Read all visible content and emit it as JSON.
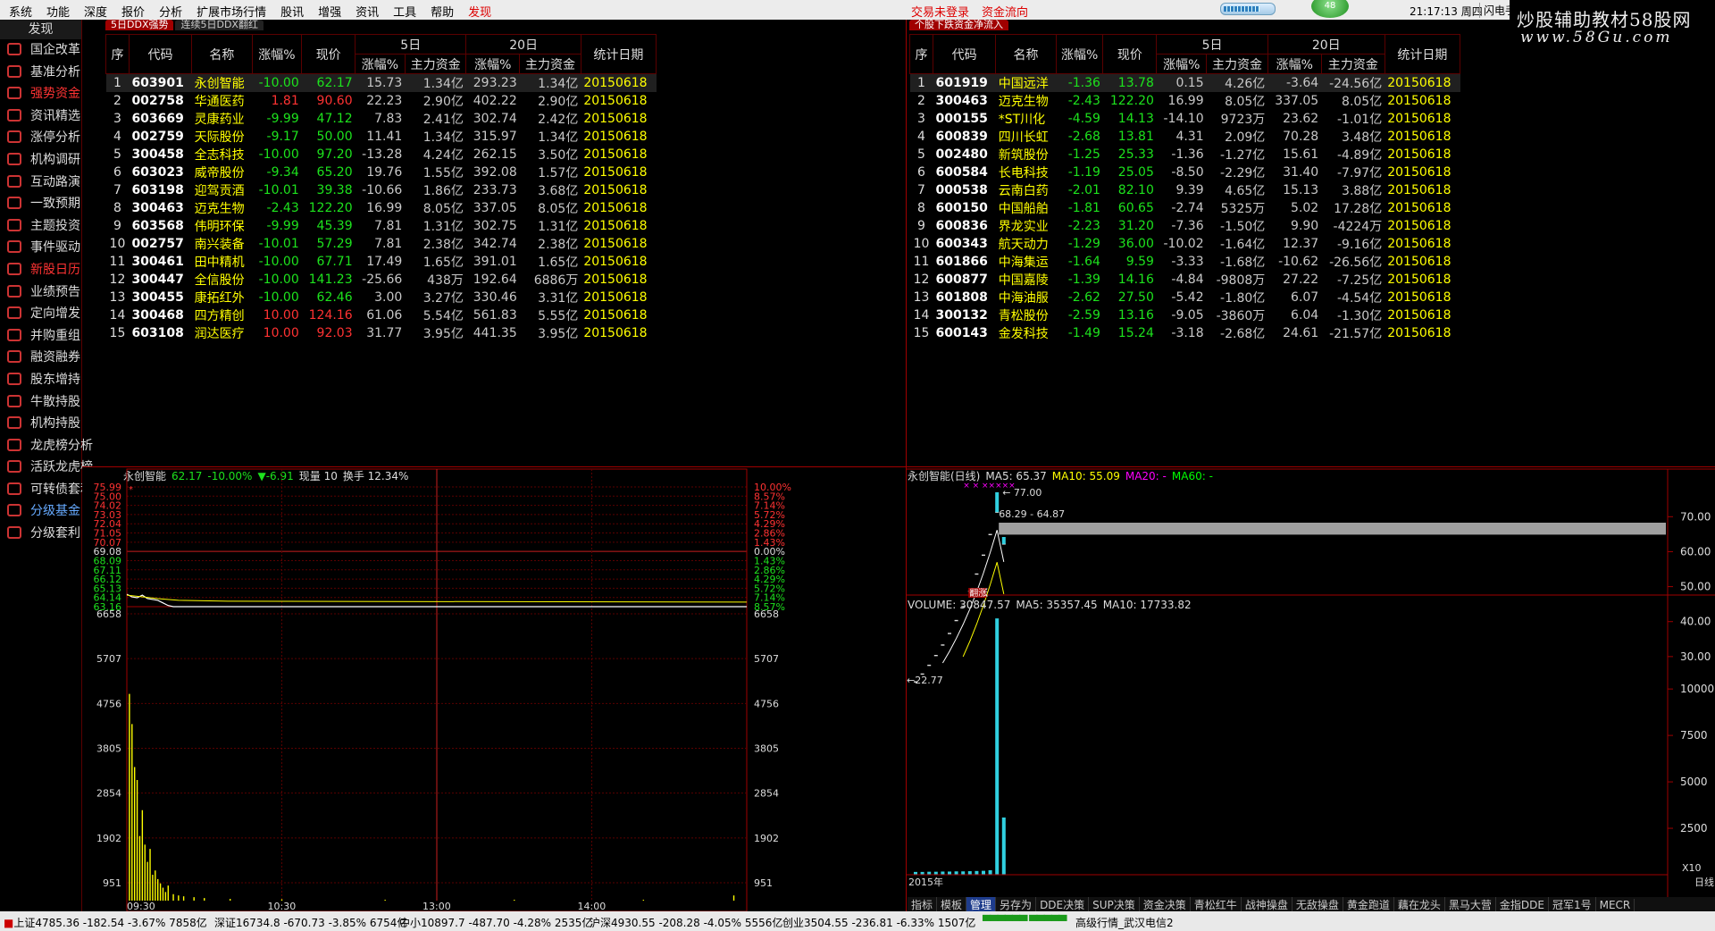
{
  "menu": [
    "系统",
    "功能",
    "深度",
    "报价",
    "分析",
    "扩展市场行情",
    "股讯",
    "增强",
    "资讯",
    "工具",
    "帮助",
    "发现"
  ],
  "login": {
    "a": "交易未登录",
    "b": "资金流向"
  },
  "orb": "48",
  "clock": "21:17:13 周四",
  "flash": "闪电手",
  "watermark": {
    "line1": "炒股辅助教材58股网",
    "line2": "www.58Gu.com"
  },
  "sidebar": {
    "title": "发现",
    "items": [
      "国企改革",
      "基准分析",
      "强势资金",
      "资讯精选",
      "涨停分析",
      "机构调研",
      "互动路演",
      "一致预期",
      "主题投资",
      "事件驱动",
      "新股日历",
      "业绩预告",
      "定向增发",
      "并购重组",
      "融资融券",
      "股东增持",
      "牛散持股",
      "机构持股",
      "龙虎榜分析",
      "活跃龙虎榜",
      "可转债套利",
      "分级基金",
      "分级套利"
    ]
  },
  "left_tabs": [
    "5日DDX强势",
    "连续5日DDX翻红"
  ],
  "right_tabs": [
    "个股下跌资金净流入"
  ],
  "headers": {
    "seq": "序",
    "code": "代码",
    "name": "名称",
    "pct": "涨幅%",
    "price": "现价",
    "d5": "5日",
    "d20": "20日",
    "sub_pct": "涨幅%",
    "sub_fund": "主力资金",
    "date": "统计日期"
  },
  "left_rows": [
    [
      "1",
      "603901",
      "永创智能",
      "-10.00",
      "62.17",
      "15.73",
      "1.34亿",
      "293.23",
      "1.34亿",
      "20150618"
    ],
    [
      "2",
      "002758",
      "华通医药",
      "1.81",
      "90.60",
      "22.23",
      "2.90亿",
      "402.22",
      "2.90亿",
      "20150618"
    ],
    [
      "3",
      "603669",
      "灵康药业",
      "-9.99",
      "47.12",
      "7.83",
      "2.41亿",
      "302.74",
      "2.42亿",
      "20150618"
    ],
    [
      "4",
      "002759",
      "天际股份",
      "-9.17",
      "50.00",
      "11.41",
      "1.34亿",
      "315.97",
      "1.34亿",
      "20150618"
    ],
    [
      "5",
      "300458",
      "全志科技",
      "-10.00",
      "97.20",
      "-13.28",
      "4.24亿",
      "262.15",
      "3.50亿",
      "20150618"
    ],
    [
      "6",
      "603023",
      "威帝股份",
      "-9.34",
      "65.20",
      "19.76",
      "1.55亿",
      "392.08",
      "1.57亿",
      "20150618"
    ],
    [
      "7",
      "603198",
      "迎驾贡酒",
      "-10.01",
      "39.38",
      "-10.66",
      "1.86亿",
      "233.73",
      "3.68亿",
      "20150618"
    ],
    [
      "8",
      "300463",
      "迈克生物",
      "-2.43",
      "122.20",
      "16.99",
      "8.05亿",
      "337.05",
      "8.05亿",
      "20150618"
    ],
    [
      "9",
      "603568",
      "伟明环保",
      "-9.99",
      "45.39",
      "7.81",
      "1.31亿",
      "302.75",
      "1.31亿",
      "20150618"
    ],
    [
      "10",
      "002757",
      "南兴装备",
      "-10.01",
      "57.29",
      "7.81",
      "2.38亿",
      "342.74",
      "2.38亿",
      "20150618"
    ],
    [
      "11",
      "300461",
      "田中精机",
      "-10.00",
      "67.71",
      "17.49",
      "1.65亿",
      "391.01",
      "1.65亿",
      "20150618"
    ],
    [
      "12",
      "300447",
      "全信股份",
      "-10.00",
      "141.23",
      "-25.66",
      "438万",
      "192.64",
      "6886万",
      "20150618"
    ],
    [
      "13",
      "300455",
      "康拓红外",
      "-10.00",
      "62.46",
      "3.00",
      "3.27亿",
      "330.46",
      "3.31亿",
      "20150618"
    ],
    [
      "14",
      "300468",
      "四方精创",
      "10.00",
      "124.16",
      "61.06",
      "5.54亿",
      "561.83",
      "5.55亿",
      "20150618"
    ],
    [
      "15",
      "603108",
      "润达医疗",
      "10.00",
      "92.03",
      "31.77",
      "3.95亿",
      "441.35",
      "3.95亿",
      "20150618"
    ]
  ],
  "right_rows": [
    [
      "1",
      "601919",
      "中国远洋",
      "-1.36",
      "13.78",
      "0.15",
      "4.26亿",
      "-3.64",
      "-24.56亿",
      "20150618"
    ],
    [
      "2",
      "300463",
      "迈克生物",
      "-2.43",
      "122.20",
      "16.99",
      "8.05亿",
      "337.05",
      "8.05亿",
      "20150618"
    ],
    [
      "3",
      "000155",
      "*ST川化",
      "-4.59",
      "14.13",
      "-14.10",
      "9723万",
      "23.62",
      "-1.01亿",
      "20150618"
    ],
    [
      "4",
      "600839",
      "四川长虹",
      "-2.68",
      "13.81",
      "4.31",
      "2.09亿",
      "70.28",
      "3.48亿",
      "20150618"
    ],
    [
      "5",
      "002480",
      "新筑股份",
      "-1.25",
      "25.33",
      "-1.36",
      "-1.27亿",
      "15.61",
      "-4.89亿",
      "20150618"
    ],
    [
      "6",
      "600584",
      "长电科技",
      "-1.19",
      "25.05",
      "-8.50",
      "-2.29亿",
      "31.40",
      "-7.97亿",
      "20150618"
    ],
    [
      "7",
      "000538",
      "云南白药",
      "-2.01",
      "82.10",
      "9.39",
      "4.65亿",
      "15.13",
      "3.88亿",
      "20150618"
    ],
    [
      "8",
      "600150",
      "中国船舶",
      "-1.81",
      "60.65",
      "-2.74",
      "5325万",
      "5.02",
      "17.28亿",
      "20150618"
    ],
    [
      "9",
      "600836",
      "界龙实业",
      "-2.23",
      "31.20",
      "-7.36",
      "-1.50亿",
      "9.90",
      "-4224万",
      "20150618"
    ],
    [
      "10",
      "600343",
      "航天动力",
      "-1.29",
      "36.00",
      "-10.02",
      "-1.64亿",
      "12.37",
      "-9.16亿",
      "20150618"
    ],
    [
      "11",
      "601866",
      "中海集运",
      "-1.64",
      "9.59",
      "-3.33",
      "-1.68亿",
      "-10.62",
      "-26.56亿",
      "20150618"
    ],
    [
      "12",
      "600877",
      "中国嘉陵",
      "-1.39",
      "14.16",
      "-4.84",
      "-9808万",
      "27.22",
      "-7.25亿",
      "20150618"
    ],
    [
      "13",
      "601808",
      "中海油服",
      "-2.62",
      "27.50",
      "-5.42",
      "-1.80亿",
      "6.07",
      "-4.54亿",
      "20150618"
    ],
    [
      "14",
      "300132",
      "青松股份",
      "-2.59",
      "13.16",
      "-9.05",
      "-3860万",
      "6.04",
      "-1.30亿",
      "20150618"
    ],
    [
      "15",
      "600143",
      "金发科技",
      "-1.49",
      "15.24",
      "-3.18",
      "-2.68亿",
      "24.61",
      "-21.57亿",
      "20150618"
    ]
  ],
  "chart_data": [
    {
      "type": "line",
      "title_name": "永创智能",
      "title_price": "62.17",
      "title_pct": "-10.00%",
      "title_chg": "▼-6.91",
      "title_vol": "现量 10",
      "title_turn": "换手 12.34%",
      "y_labels": [
        "75.99",
        "75.00",
        "74.02",
        "73.03",
        "72.04",
        "71.05",
        "70.07",
        "69.08",
        "68.09",
        "67.11",
        "66.12",
        "65.13",
        "64.14",
        "63.16"
      ],
      "pct_labels": [
        "10.00%",
        "8.57%",
        "7.14%",
        "5.72%",
        "4.29%",
        "2.86%",
        "1.43%",
        "0.00%",
        "1.43%",
        "2.86%",
        "4.29%",
        "5.72%",
        "7.14%",
        "8.57%"
      ],
      "vol_labels": [
        "6658",
        "5707",
        "4756",
        "3805",
        "2854",
        "1902",
        "951"
      ],
      "x_labels": [
        "09:30",
        "10:30",
        "13:00",
        "14:00"
      ],
      "ylim": [
        62.17,
        75.99
      ],
      "preclose": 69.08,
      "price": [
        [
          0,
          63.6
        ],
        [
          2,
          63.3
        ],
        [
          4,
          63.2
        ],
        [
          6,
          63.5
        ],
        [
          8,
          63.1
        ],
        [
          10,
          63.0
        ],
        [
          12,
          62.9
        ],
        [
          14,
          62.6
        ],
        [
          16,
          62.3
        ],
        [
          18,
          62.17
        ],
        [
          240,
          62.17
        ]
      ],
      "avg": [
        [
          0,
          63.5
        ],
        [
          6,
          63.3
        ],
        [
          12,
          63.1
        ],
        [
          20,
          62.9
        ],
        [
          40,
          62.8
        ],
        [
          240,
          62.7
        ]
      ],
      "volume_max": 6658,
      "volume": [
        [
          1,
          4800
        ],
        [
          2,
          4100
        ],
        [
          3,
          3100
        ],
        [
          4,
          2800
        ],
        [
          5,
          1500
        ],
        [
          6,
          2100
        ],
        [
          7,
          1300
        ],
        [
          8,
          900
        ],
        [
          9,
          1200
        ],
        [
          10,
          600
        ],
        [
          11,
          700
        ],
        [
          12,
          500
        ],
        [
          13,
          400
        ],
        [
          14,
          300
        ],
        [
          15,
          200
        ],
        [
          16,
          350
        ],
        [
          18,
          150
        ],
        [
          20,
          120
        ],
        [
          22,
          100
        ],
        [
          26,
          80
        ],
        [
          30,
          60
        ],
        [
          40,
          40
        ],
        [
          60,
          30
        ],
        [
          100,
          20
        ],
        [
          150,
          20
        ],
        [
          200,
          20
        ],
        [
          235,
          120
        ]
      ]
    },
    {
      "type": "bar",
      "title": "永创智能(日线)",
      "ma5": "MA5: 65.37",
      "ma10": "MA10: 55.09",
      "ma20": "MA20: -",
      "ma60": "MA60: -",
      "y_labels": [
        "70.00",
        "60.00",
        "50.00",
        "40.00",
        "30.00"
      ],
      "ylim": [
        20,
        78
      ],
      "high_label": "77.00",
      "range_label": "68.29 - 64.87",
      "low_label": "22.77",
      "tag": "翻涨",
      "candles": [
        [
          0,
          22.77,
          22.77
        ],
        [
          1,
          25.0,
          25.0
        ],
        [
          2,
          27.5,
          27.5
        ],
        [
          3,
          30.3,
          30.3
        ],
        [
          4,
          33.3,
          33.3
        ],
        [
          5,
          36.6,
          36.6
        ],
        [
          6,
          40.3,
          40.3
        ],
        [
          7,
          44.3,
          44.3
        ],
        [
          8,
          48.7,
          48.7
        ],
        [
          9,
          53.6,
          53.6
        ],
        [
          10,
          59.0,
          59.0
        ],
        [
          11,
          64.9,
          64.9
        ],
        [
          12,
          71.3,
          77.0
        ],
        [
          13,
          62.2,
          64.2
        ]
      ],
      "vol_title": "VOLUME: 30847.57",
      "vol_ma5": "MA5: 35357.45",
      "vol_ma10": "MA10: 17733.82",
      "vol_labels": [
        "10000",
        "7500",
        "5000",
        "2500"
      ],
      "vol_unit": "X10",
      "year": "2015年",
      "period": "日线",
      "vols": [
        [
          0,
          150
        ],
        [
          1,
          150
        ],
        [
          2,
          160
        ],
        [
          3,
          160
        ],
        [
          4,
          170
        ],
        [
          5,
          170
        ],
        [
          6,
          180
        ],
        [
          7,
          180
        ],
        [
          8,
          190
        ],
        [
          9,
          200
        ],
        [
          10,
          210
        ],
        [
          11,
          240
        ],
        [
          12,
          13800
        ],
        [
          13,
          3080
        ]
      ]
    }
  ],
  "bottom_tabs": [
    "指标",
    "模板",
    "管理",
    "另存为",
    "DDE决策",
    "SUP决策",
    "资金决策",
    "青松红牛",
    "战神操盘",
    "无敌操盘",
    "黄金跑道",
    "藕在龙头",
    "黑马大营",
    "金指DDE",
    "冠军1号",
    "MECR"
  ],
  "status": {
    "sh": "上证4785.36 -182.54 -3.67% 7858亿",
    "sz": "深证16734.8 -670.73 -3.85% 6754亿",
    "zx": "中小10897.7 -487.70 -4.28% 2535亿",
    "hs": "沪深4930.55 -208.28 -4.05% 5556亿",
    "cy": "创业3504.55 -236.81 -6.33% 1507亿",
    "net": "高级行情_武汉电信2"
  }
}
